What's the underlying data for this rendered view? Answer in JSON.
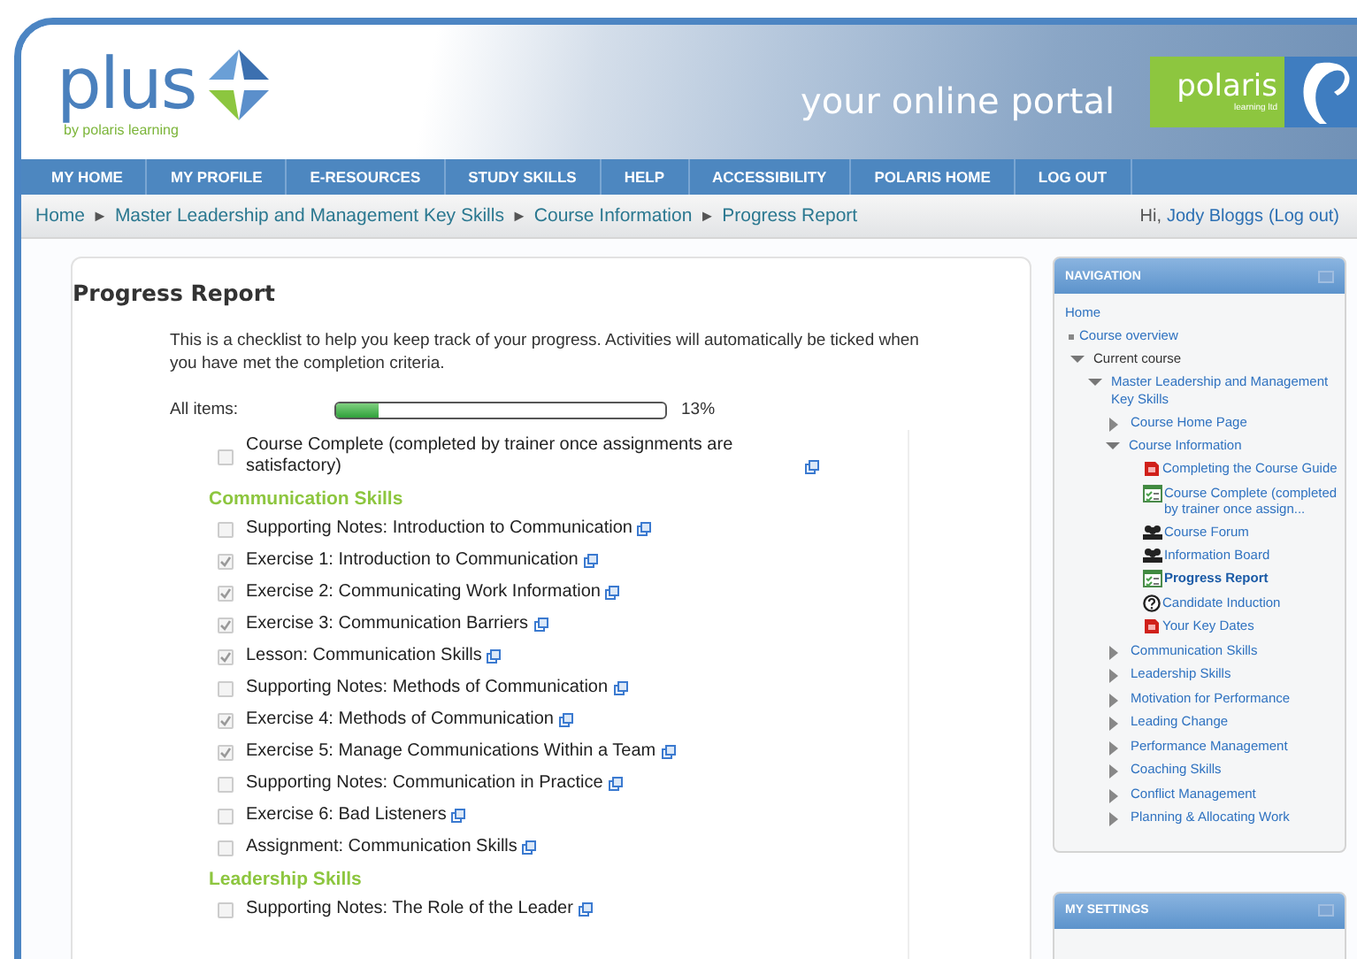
{
  "header": {
    "logo": "plus",
    "logo_sub": "by polaris learning",
    "tagline": "your online portal",
    "brand": "polaris",
    "brand_sub": "learning ltd"
  },
  "menu": [
    "MY HOME",
    "MY PROFILE",
    "E-RESOURCES",
    "STUDY SKILLS",
    "HELP",
    "ACCESSIBILITY",
    "POLARIS HOME",
    "LOG OUT"
  ],
  "breadcrumb": {
    "items": [
      "Home",
      "Master Leadership and Management Key Skills",
      "Course Information",
      "Progress Report"
    ],
    "separator": "►",
    "greeting": "Hi,",
    "user": "Jody Bloggs",
    "logout": "(Log out)"
  },
  "report": {
    "title": "Progress Report",
    "intro": "This is a checklist to help you keep track of your progress. Activities will automatically be ticked when you have met the completion criteria.",
    "progress_label": "All items:",
    "level": 0.13,
    "reading": "13%",
    "items": [
      {
        "kind": "item",
        "label": "Course Complete (completed by trainer once assignments are satisfactory)",
        "checked": false
      },
      {
        "kind": "heading",
        "label": "Communication Skills"
      },
      {
        "kind": "item",
        "label": "Supporting Notes: Introduction to Communication",
        "checked": false
      },
      {
        "kind": "item",
        "label": "Exercise 1: Introduction to Communication",
        "checked": true
      },
      {
        "kind": "item",
        "label": "Exercise 2: Communicating Work Information",
        "checked": true
      },
      {
        "kind": "item",
        "label": "Exercise 3: Communication Barriers",
        "checked": true
      },
      {
        "kind": "item",
        "label": "Lesson: Communication Skills",
        "checked": true
      },
      {
        "kind": "item",
        "label": "Supporting Notes: Methods of Communication",
        "checked": false
      },
      {
        "kind": "item",
        "label": "Exercise 4: Methods of Communication",
        "checked": true
      },
      {
        "kind": "item",
        "label": "Exercise 5: Manage Communications Within a Team",
        "checked": true
      },
      {
        "kind": "item",
        "label": "Supporting Notes: Communication in Practice",
        "checked": false
      },
      {
        "kind": "item",
        "label": "Exercise 6: Bad Listeners",
        "checked": false
      },
      {
        "kind": "item",
        "label": "Assignment: Communication Skills",
        "checked": false
      },
      {
        "kind": "heading",
        "label": "Leadership Skills"
      },
      {
        "kind": "item",
        "label": "Supporting Notes: The Role of the Leader",
        "checked": false
      }
    ]
  },
  "navigation": {
    "title": "NAVIGATION",
    "tree": [
      {
        "kind": "plain",
        "label": "Home"
      },
      {
        "kind": "bullet",
        "label": "Course overview"
      },
      {
        "kind": "branch",
        "label": "Current course",
        "expanded": true,
        "children": [
          {
            "kind": "branch",
            "label": "Master Leadership and Management Key Skills",
            "expanded": true,
            "children": [
              {
                "kind": "branch",
                "label": "Course Home Page",
                "expanded": false
              },
              {
                "kind": "branch",
                "label": "Course Information",
                "expanded": true,
                "children": [
                  {
                    "kind": "pdf",
                    "label": "Completing the Course Guide",
                    "selected": false
                  },
                  {
                    "kind": "checklist",
                    "label": "Course Complete (completed by trainer once assign...",
                    "selected": false
                  },
                  {
                    "kind": "forum",
                    "label": "Course Forum",
                    "selected": false
                  },
                  {
                    "kind": "forum",
                    "label": "Information Board",
                    "selected": false
                  },
                  {
                    "kind": "checklist",
                    "label": "Progress Report",
                    "selected": true
                  },
                  {
                    "kind": "help",
                    "label": "Candidate Induction",
                    "selected": false
                  },
                  {
                    "kind": "pdf",
                    "label": "Your Key Dates",
                    "selected": false
                  }
                ]
              },
              {
                "kind": "branch",
                "label": "Communication Skills",
                "expanded": false
              },
              {
                "kind": "branch",
                "label": "Leadership Skills",
                "expanded": false
              },
              {
                "kind": "branch",
                "label": "Motivation for Performance",
                "expanded": false
              },
              {
                "kind": "branch",
                "label": "Leading Change",
                "expanded": false
              },
              {
                "kind": "branch",
                "label": "Performance Management",
                "expanded": false
              },
              {
                "kind": "branch",
                "label": "Coaching Skills",
                "expanded": false
              },
              {
                "kind": "branch",
                "label": "Conflict Management",
                "expanded": false
              },
              {
                "kind": "branch",
                "label": "Planning & Allocating Work",
                "expanded": false
              }
            ]
          }
        ]
      }
    ]
  },
  "settings": {
    "title": "MY SETTINGS"
  }
}
